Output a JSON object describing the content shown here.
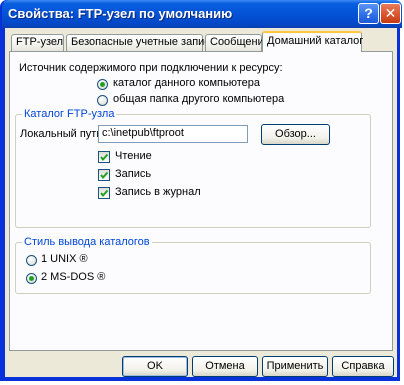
{
  "window": {
    "title": "Свойства: FTP-узел по умолчанию",
    "help_glyph": "?",
    "close_glyph": "✕"
  },
  "tabs": [
    {
      "label": "FTP-узел"
    },
    {
      "label": "Безопасные учетные записи"
    },
    {
      "label": "Сообщения"
    },
    {
      "label": "Домашний каталог"
    }
  ],
  "content_source": {
    "label": "Источник содержимого при подключении к ресурсу:",
    "options": [
      {
        "label": "каталог данного компьютера",
        "selected": true
      },
      {
        "label": "общая папка другого компьютера",
        "selected": false
      }
    ]
  },
  "ftp_directory": {
    "group_label": "Каталог FTP-узла",
    "local_path_label": "Локальный путь:",
    "local_path_value": "c:\\inetpub\\ftproot",
    "browse_label": "Обзор...",
    "checkboxes": [
      {
        "label": "Чтение",
        "checked": true
      },
      {
        "label": "Запись",
        "checked": true
      },
      {
        "label": "Запись в журнал",
        "checked": true
      }
    ]
  },
  "listing_style": {
    "group_label": "Стиль вывода каталогов",
    "options": [
      {
        "label": "1 UNIX ®",
        "selected": false
      },
      {
        "label": "2 MS-DOS ®",
        "selected": true
      }
    ]
  },
  "footer": {
    "ok_label": "OK",
    "cancel_label": "Отмена",
    "apply_label": "Применить",
    "help_label": "Справка"
  },
  "colors": {
    "titlebar": "#0454d8",
    "legend_text": "#0046d5",
    "client_bg": "#ece9d8",
    "selected_dot": "#21a121",
    "active_tab_accent": "#ffc83c"
  }
}
